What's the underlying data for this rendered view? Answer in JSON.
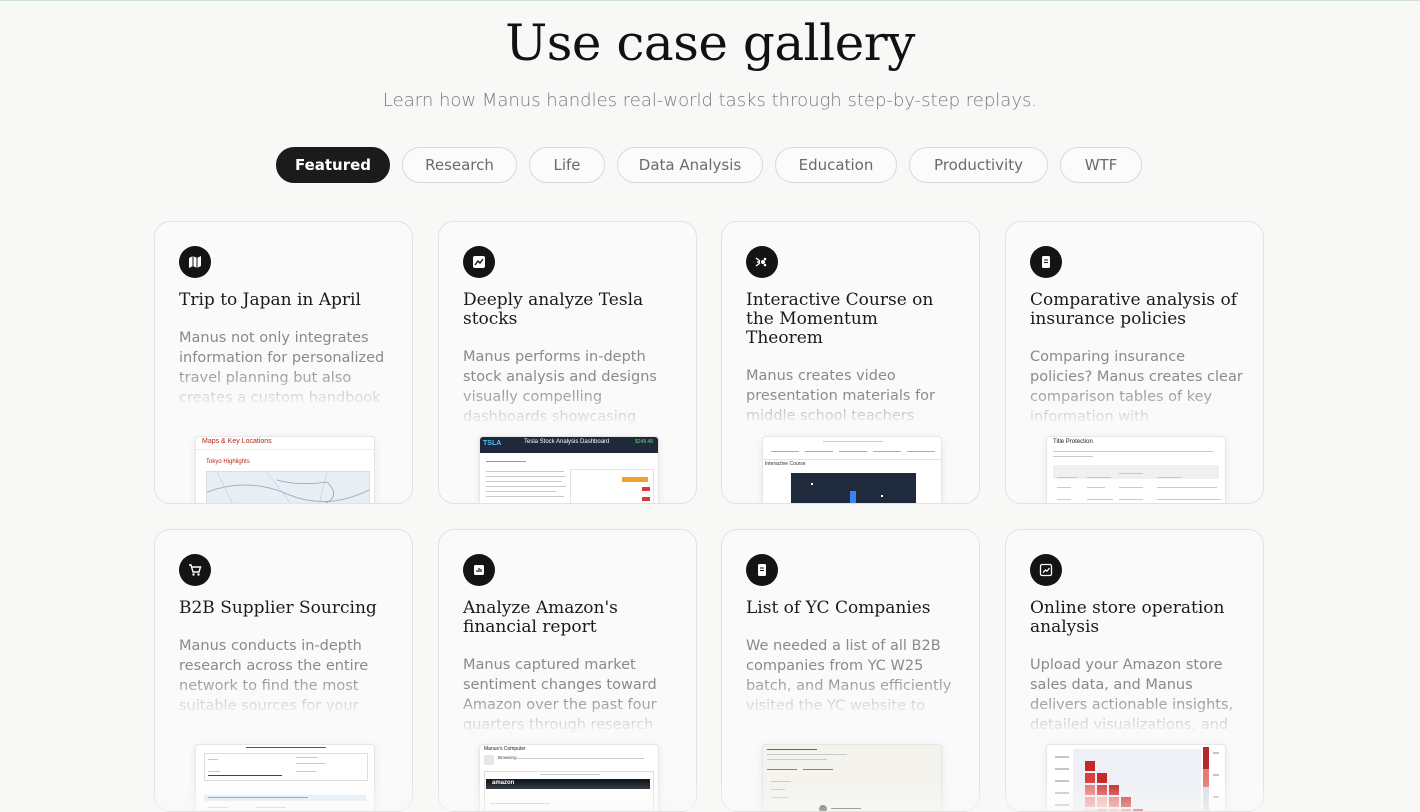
{
  "header": {
    "title": "Use case gallery",
    "subtitle": "Learn how Manus handles real-world tasks through step-by-step replays."
  },
  "tabs": [
    {
      "label": "Featured",
      "active": true
    },
    {
      "label": "Research",
      "active": false
    },
    {
      "label": "Life",
      "active": false
    },
    {
      "label": "Data Analysis",
      "active": false
    },
    {
      "label": "Education",
      "active": false
    },
    {
      "label": "Productivity",
      "active": false
    },
    {
      "label": "WTF",
      "active": false
    }
  ],
  "cards": [
    {
      "icon": "map-icon",
      "title": "Trip to Japan in April",
      "description": "Manus not only integrates information for personalized travel planning but also creates a custom handbook for your trip.",
      "thumb": {
        "heading": "Maps & Key Locations",
        "subheading": "Tokyo Highlights"
      }
    },
    {
      "icon": "chart-icon",
      "title": "Deeply analyze Tesla stocks",
      "description": "Manus performs in-depth stock analysis and designs visually compelling dashboards showcasing",
      "thumb": {
        "heading": "Tesla Stock Analysis Dashboard",
        "badge": "TSLA",
        "price": "$248.48"
      }
    },
    {
      "icon": "atom-icon",
      "title": "Interactive Course on the Momentum Theorem",
      "description": "Manus creates video presentation materials for middle school teachers",
      "thumb": {
        "heading": "Interactive Course"
      }
    },
    {
      "icon": "document-icon",
      "title": "Comparative analysis of insurance policies",
      "description": "Comparing insurance policies? Manus creates clear comparison tables of key information with",
      "thumb": {
        "heading": "Title Protection"
      }
    },
    {
      "icon": "cart-icon",
      "title": "B2B Supplier Sourcing",
      "description": "Manus conducts in-depth research across the entire network to find the most suitable sources for your needs. manus is a truly fair",
      "thumb": {
        "heading": ""
      }
    },
    {
      "icon": "report-icon",
      "title": "Analyze Amazon's financial report",
      "description": "Manus captured market sentiment changes toward Amazon over the past four quarters through research",
      "thumb": {
        "heading": "Manus's Computer",
        "subheading": "Browsing",
        "brand": "amazon"
      }
    },
    {
      "icon": "document-icon",
      "title": "List of YC Companies",
      "description": "We needed a list of all B2B companies from YC W25 batch, and Manus efficiently visited the YC website to identify qualifying",
      "thumb": {
        "heading": ""
      }
    },
    {
      "icon": "analytics-icon",
      "title": "Online store operation analysis",
      "description": "Upload your Amazon store sales data, and Manus delivers actionable insights, detailed visualizations, and",
      "thumb": {
        "heading": ""
      }
    }
  ],
  "colors": {
    "background": "#f8f8f7",
    "active_tab": "#1b1b1b",
    "card_border": "#e2e2e2",
    "muted_text": "#8a8a8a"
  }
}
